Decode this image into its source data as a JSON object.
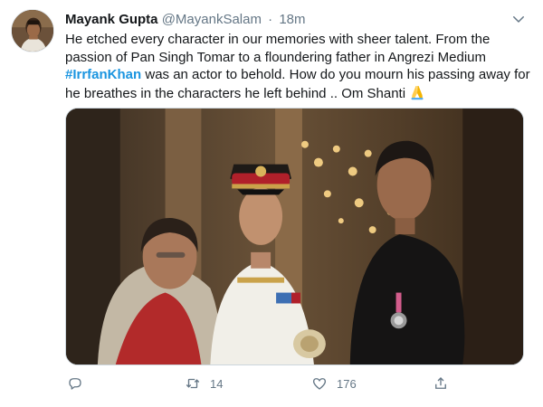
{
  "tweet": {
    "author": {
      "name": "Mayank Gupta",
      "handle": "@MayankSalam",
      "separator": "·",
      "time": "18m"
    },
    "text": {
      "part1": "He etched every character in our memories with sheer talent. From the passion of Pan Singh Tomar to a floundering father in Angrezi Medium ",
      "hashtag": "#IrrfanKhan",
      "part2": " was an actor to behold. How do you mourn his passing away for he breathes in the characters he left behind .. Om Shanti "
    },
    "media": {
      "description": "photo"
    },
    "actions": {
      "reply_count": "",
      "retweet_count": "14",
      "like_count": "176"
    }
  },
  "colors": {
    "accent": "#1b95e0",
    "secondary_text": "#657786",
    "primary_text": "#14171a",
    "border": "#ccd6dd"
  },
  "icons": [
    "more-caret-icon",
    "folded-hands-emoji-icon",
    "reply-icon",
    "retweet-icon",
    "like-icon",
    "share-icon"
  ]
}
